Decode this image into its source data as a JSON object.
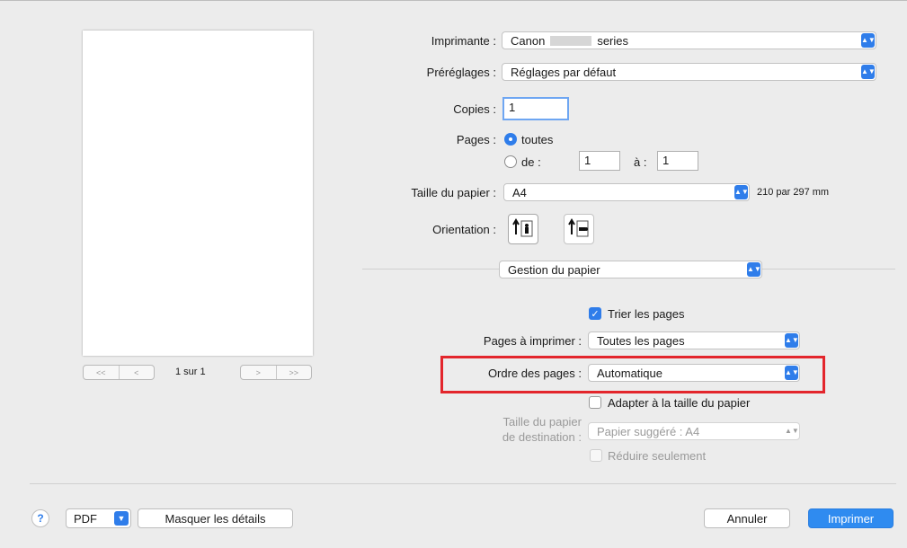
{
  "preview": {
    "nav_first": "<<",
    "nav_prev": "<",
    "page_indicator": "1 sur 1",
    "nav_next": ">",
    "nav_last": ">>"
  },
  "printer": {
    "label": "Imprimante :",
    "value_left": "Canon",
    "value_right": "series"
  },
  "presets": {
    "label": "Préréglages :",
    "value": "Réglages par défaut"
  },
  "copies": {
    "label": "Copies :",
    "value": "1"
  },
  "pages": {
    "label": "Pages :",
    "all_label": "toutes",
    "from_label": "de :",
    "from_value": "1",
    "to_label": "à :",
    "to_value": "1"
  },
  "paper_size": {
    "label": "Taille du papier :",
    "value": "A4",
    "dimensions": "210 par 297 mm"
  },
  "orientation": {
    "label": "Orientation :"
  },
  "section": {
    "value": "Gestion du papier"
  },
  "collate": {
    "label": "Trier les pages",
    "checked": true
  },
  "pages_to_print": {
    "label": "Pages à imprimer :",
    "value": "Toutes les pages"
  },
  "page_order": {
    "label": "Ordre des pages :",
    "value": "Automatique"
  },
  "scale_to_fit": {
    "label": "Adapter à la taille du papier",
    "checked": false
  },
  "dest_paper": {
    "label_line1": "Taille du papier",
    "label_line2": "de destination :",
    "value": "Papier suggéré : A4"
  },
  "scale_down_only": {
    "label": "Réduire seulement"
  },
  "footer": {
    "help": "?",
    "pdf": "PDF",
    "hide_details": "Masquer les détails",
    "cancel": "Annuler",
    "print": "Imprimer"
  },
  "colors": {
    "accent": "#2f7dea",
    "highlight": "#e3262c"
  }
}
